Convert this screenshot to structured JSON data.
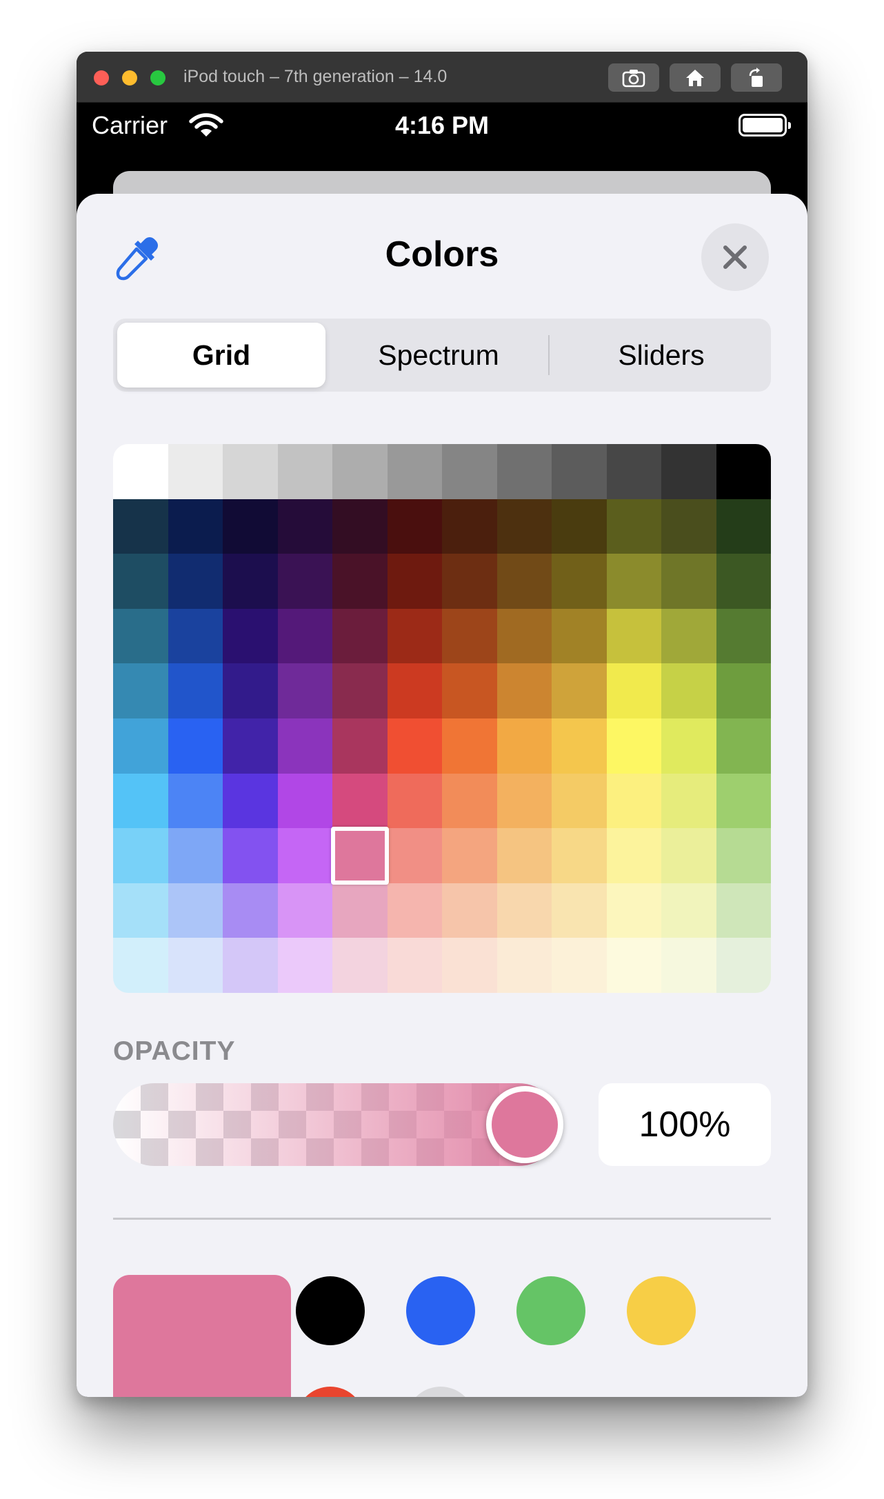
{
  "window": {
    "title": "iPod touch – 7th generation – 14.0",
    "toolbar": [
      "camera-icon",
      "home-icon",
      "rotate-icon"
    ]
  },
  "status_bar": {
    "carrier": "Carrier",
    "time": "4:16 PM",
    "icons": [
      "wifi-icon",
      "battery-icon"
    ]
  },
  "sheet": {
    "title": "Colors",
    "tabs": [
      {
        "label": "Grid",
        "selected": true
      },
      {
        "label": "Spectrum",
        "selected": false
      },
      {
        "label": "Sliders",
        "selected": false
      }
    ],
    "selected_cell": {
      "row": 7,
      "col": 4
    },
    "grid_colors": [
      [
        "#ffffff",
        "#ebebeb",
        "#d6d6d6",
        "#c2c2c2",
        "#adadad",
        "#999999",
        "#858585",
        "#707070",
        "#5c5c5c",
        "#474747",
        "#333333",
        "#000000"
      ],
      [
        "#16334a",
        "#0b1c4e",
        "#110b35",
        "#250c39",
        "#330d23",
        "#4a0f0e",
        "#4b1f0d",
        "#4d300f",
        "#4a3c0f",
        "#5b5e1d",
        "#4a4e1d",
        "#243d19"
      ],
      [
        "#1e4d63",
        "#112c70",
        "#1c0e4e",
        "#3a1254",
        "#4a1228",
        "#6e1a0f",
        "#6d2e12",
        "#714a17",
        "#716019",
        "#8b8b2c",
        "#6f7628",
        "#3c5823"
      ],
      [
        "#296d8a",
        "#1a429e",
        "#2a1070",
        "#541979",
        "#6b1d3c",
        "#9c2a17",
        "#9d451a",
        "#a06a22",
        "#a18226",
        "#c6c13c",
        "#a0a839",
        "#557b31"
      ],
      [
        "#3589b2",
        "#2155cb",
        "#321b8b",
        "#6f2a99",
        "#892b4e",
        "#cc3a21",
        "#c85622",
        "#cc8530",
        "#cfa33a",
        "#f1ea4d",
        "#c6d147",
        "#6e9d3e"
      ],
      [
        "#41a3d9",
        "#2962f2",
        "#4123a9",
        "#8b34bc",
        "#a9365e",
        "#f04f32",
        "#f07535",
        "#f2a944",
        "#f4c64d",
        "#fdf763",
        "#e0ea5e",
        "#82b551"
      ],
      [
        "#54c3f7",
        "#4c84f5",
        "#5a35e0",
        "#b147e6",
        "#d54a7e",
        "#ef6b5b",
        "#f28c59",
        "#f3b15f",
        "#f4cb65",
        "#fcf07f",
        "#e6ec7c",
        "#9ecf6e"
      ],
      [
        "#78d1f8",
        "#7ea7f6",
        "#8352f0",
        "#c566f5",
        "#de779c",
        "#f18f85",
        "#f4a57f",
        "#f5c481",
        "#f7d887",
        "#fcf39c",
        "#ebef9a",
        "#b6db93"
      ],
      [
        "#a5e0f9",
        "#acc5f8",
        "#a88cf3",
        "#d894f6",
        "#e7a6bf",
        "#f5b5ae",
        "#f6c5aa",
        "#f8d7ad",
        "#f9e4b0",
        "#fcf6bd",
        "#f1f4bc",
        "#cfe6b9"
      ],
      [
        "#d2effb",
        "#d8e3fb",
        "#d4c7f8",
        "#ebc9fa",
        "#f3d3df",
        "#f9dad7",
        "#fae1d4",
        "#fbebd6",
        "#fcf1d8",
        "#fdfade",
        "#f6f8de",
        "#e5f0dc"
      ]
    ],
    "opacity": {
      "label": "OPACITY",
      "value_text": "100%",
      "level": 1.0
    },
    "current_color": "#de779c",
    "favorites": [
      {
        "name": "black",
        "color": "#000000"
      },
      {
        "name": "blue",
        "color": "#2962f2"
      },
      {
        "name": "green",
        "color": "#65c466"
      },
      {
        "name": "yellow",
        "color": "#f7ce46"
      },
      {
        "name": "red",
        "color": "#e9452f"
      },
      {
        "name": "light-gray",
        "color": "#d9d9dc"
      }
    ]
  }
}
